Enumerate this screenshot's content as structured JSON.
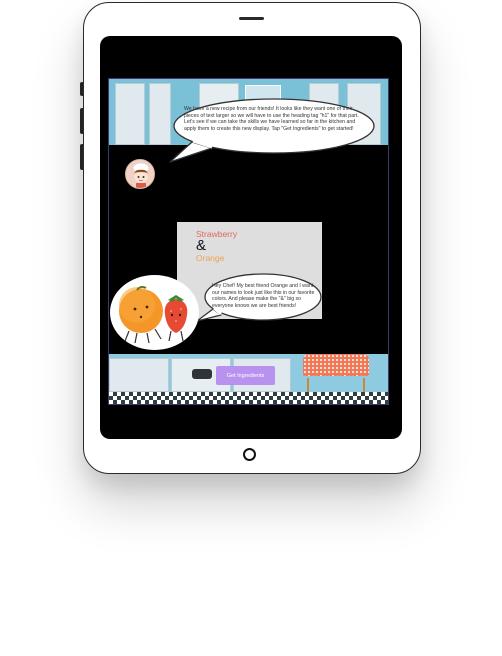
{
  "dialogs": {
    "chef_message": "We have a new recipe from our friends! It looks like they want one of their pieces of text larger so we will have to use the heading tag \"h1\" for that part. Let's see if we can take the skills we have learned so far in the kitchen and apply them to create this new display. Tap \"Get Ingredients\" to get started!",
    "fruit_message": "Hey Chef! My best friend Orange and I want our names to look just like this in our favorite colors. And please make the \"&\" big so everyone knows we are best friends!"
  },
  "recipe_card": {
    "word1": "Strawberry",
    "ampersand": "&",
    "word2": "Orange",
    "word1_color": "#e06a5c",
    "word2_color": "#f2a150"
  },
  "actions": {
    "get_ingredients_label": "Get Ingredients"
  },
  "icons": {
    "chef": "chef-avatar-icon",
    "orange": "orange-character-icon",
    "strawberry": "strawberry-character-icon"
  },
  "colors": {
    "button": "#b992ef",
    "kitchen_wall": "#7ac0d6",
    "table_cloth": "#f07a57"
  }
}
